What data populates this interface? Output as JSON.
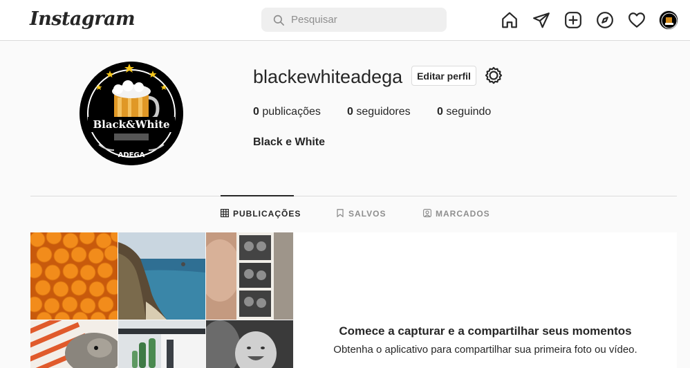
{
  "topnav": {
    "logo": "Instagram",
    "search_placeholder": "Pesquisar",
    "icons": [
      "home-icon",
      "direct-icon",
      "new-post-icon",
      "explore-icon",
      "activity-icon",
      "profile-avatar"
    ]
  },
  "profile": {
    "username": "blackewhiteadega",
    "edit_label": "Editar perfil",
    "stats": {
      "posts_count": "0",
      "posts_label": "publicações",
      "followers_count": "0",
      "followers_label": "seguidores",
      "following_count": "0",
      "following_label": "seguindo"
    },
    "full_name": "Black e White",
    "logo_text": {
      "brand": "Black&White",
      "sub": "ADEGA"
    }
  },
  "tabs": [
    {
      "label": "PUBLICAÇÕES",
      "icon": "grid-icon",
      "active": true
    },
    {
      "label": "SALVOS",
      "icon": "bookmark-icon",
      "active": false
    },
    {
      "label": "MARCADOS",
      "icon": "tagged-icon",
      "active": false
    }
  ],
  "gallery": {
    "photos": [
      "oranges",
      "coastline",
      "photo-booth-strip",
      "dog-on-striped-blanket",
      "cactus-building",
      "laughing-baby"
    ]
  },
  "empty_state": {
    "title": "Comece a capturar e a compartilhar seus momentos",
    "subtitle": "Obtenha o aplicativo para compartilhar sua primeira foto ou vídeo."
  },
  "colors": {
    "background": "#fafafa",
    "border": "#dbdbdb",
    "text": "#262626",
    "muted": "#8e8e8e"
  }
}
